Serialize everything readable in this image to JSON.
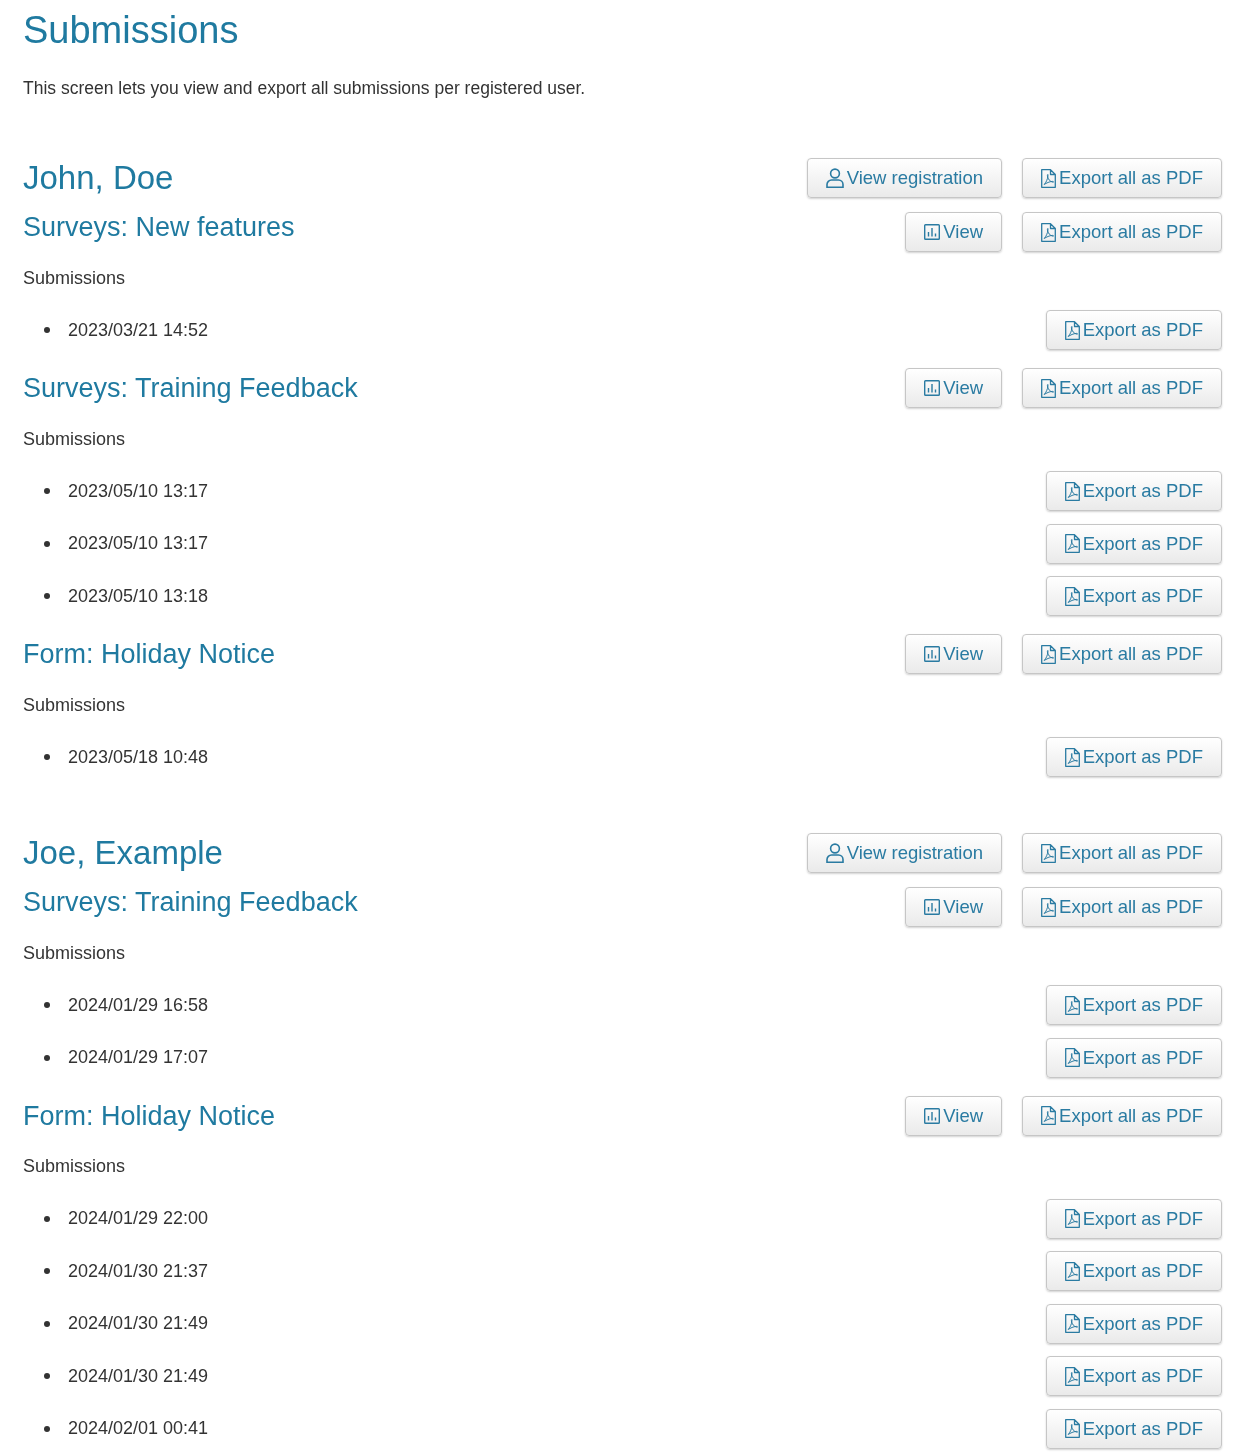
{
  "page": {
    "title": "Submissions",
    "description": "This screen lets you view and export all submissions per registered user."
  },
  "users": [
    {
      "name": "John, Doe",
      "buttons": [
        {
          "kind": "registration",
          "label": "View registration"
        },
        {
          "kind": "pdf",
          "label": "Export all as PDF"
        }
      ],
      "forms": [
        {
          "title": "Surveys: New features",
          "buttons": [
            {
              "kind": "chart",
              "label": "View"
            },
            {
              "kind": "pdf",
              "label": "Export all as PDF"
            }
          ],
          "submissions_label": "Submissions",
          "submissions": [
            {
              "date": "2023/03/21 14:52",
              "button": "Export as PDF"
            }
          ]
        },
        {
          "title": "Surveys: Training Feedback",
          "buttons": [
            {
              "kind": "chart",
              "label": "View"
            },
            {
              "kind": "pdf",
              "label": "Export all as PDF"
            }
          ],
          "submissions_label": "Submissions",
          "submissions": [
            {
              "date": "2023/05/10 13:17",
              "button": "Export as PDF"
            },
            {
              "date": "2023/05/10 13:17",
              "button": "Export as PDF"
            },
            {
              "date": "2023/05/10 13:18",
              "button": "Export as PDF"
            }
          ]
        },
        {
          "title": "Form: Holiday Notice",
          "buttons": [
            {
              "kind": "chart",
              "label": "View"
            },
            {
              "kind": "pdf",
              "label": "Export all as PDF"
            }
          ],
          "submissions_label": "Submissions",
          "submissions": [
            {
              "date": "2023/05/18 10:48",
              "button": "Export as PDF"
            }
          ]
        }
      ]
    },
    {
      "name": "Joe, Example",
      "buttons": [
        {
          "kind": "registration",
          "label": "View registration"
        },
        {
          "kind": "pdf",
          "label": "Export all as PDF"
        }
      ],
      "forms": [
        {
          "title": "Surveys: Training Feedback",
          "buttons": [
            {
              "kind": "chart",
              "label": "View"
            },
            {
              "kind": "pdf",
              "label": "Export all as PDF"
            }
          ],
          "submissions_label": "Submissions",
          "submissions": [
            {
              "date": "2024/01/29 16:58",
              "button": "Export as PDF"
            },
            {
              "date": "2024/01/29 17:07",
              "button": "Export as PDF"
            }
          ]
        },
        {
          "title": "Form: Holiday Notice",
          "buttons": [
            {
              "kind": "chart",
              "label": "View"
            },
            {
              "kind": "pdf",
              "label": "Export all as PDF"
            }
          ],
          "submissions_label": "Submissions",
          "submissions": [
            {
              "date": "2024/01/29 22:00",
              "button": "Export as PDF"
            },
            {
              "date": "2024/01/30 21:37",
              "button": "Export as PDF"
            },
            {
              "date": "2024/01/30 21:49",
              "button": "Export as PDF"
            },
            {
              "date": "2024/01/30 21:49",
              "button": "Export as PDF"
            },
            {
              "date": "2024/02/01 00:41",
              "button": "Export as PDF"
            }
          ]
        }
      ]
    }
  ]
}
